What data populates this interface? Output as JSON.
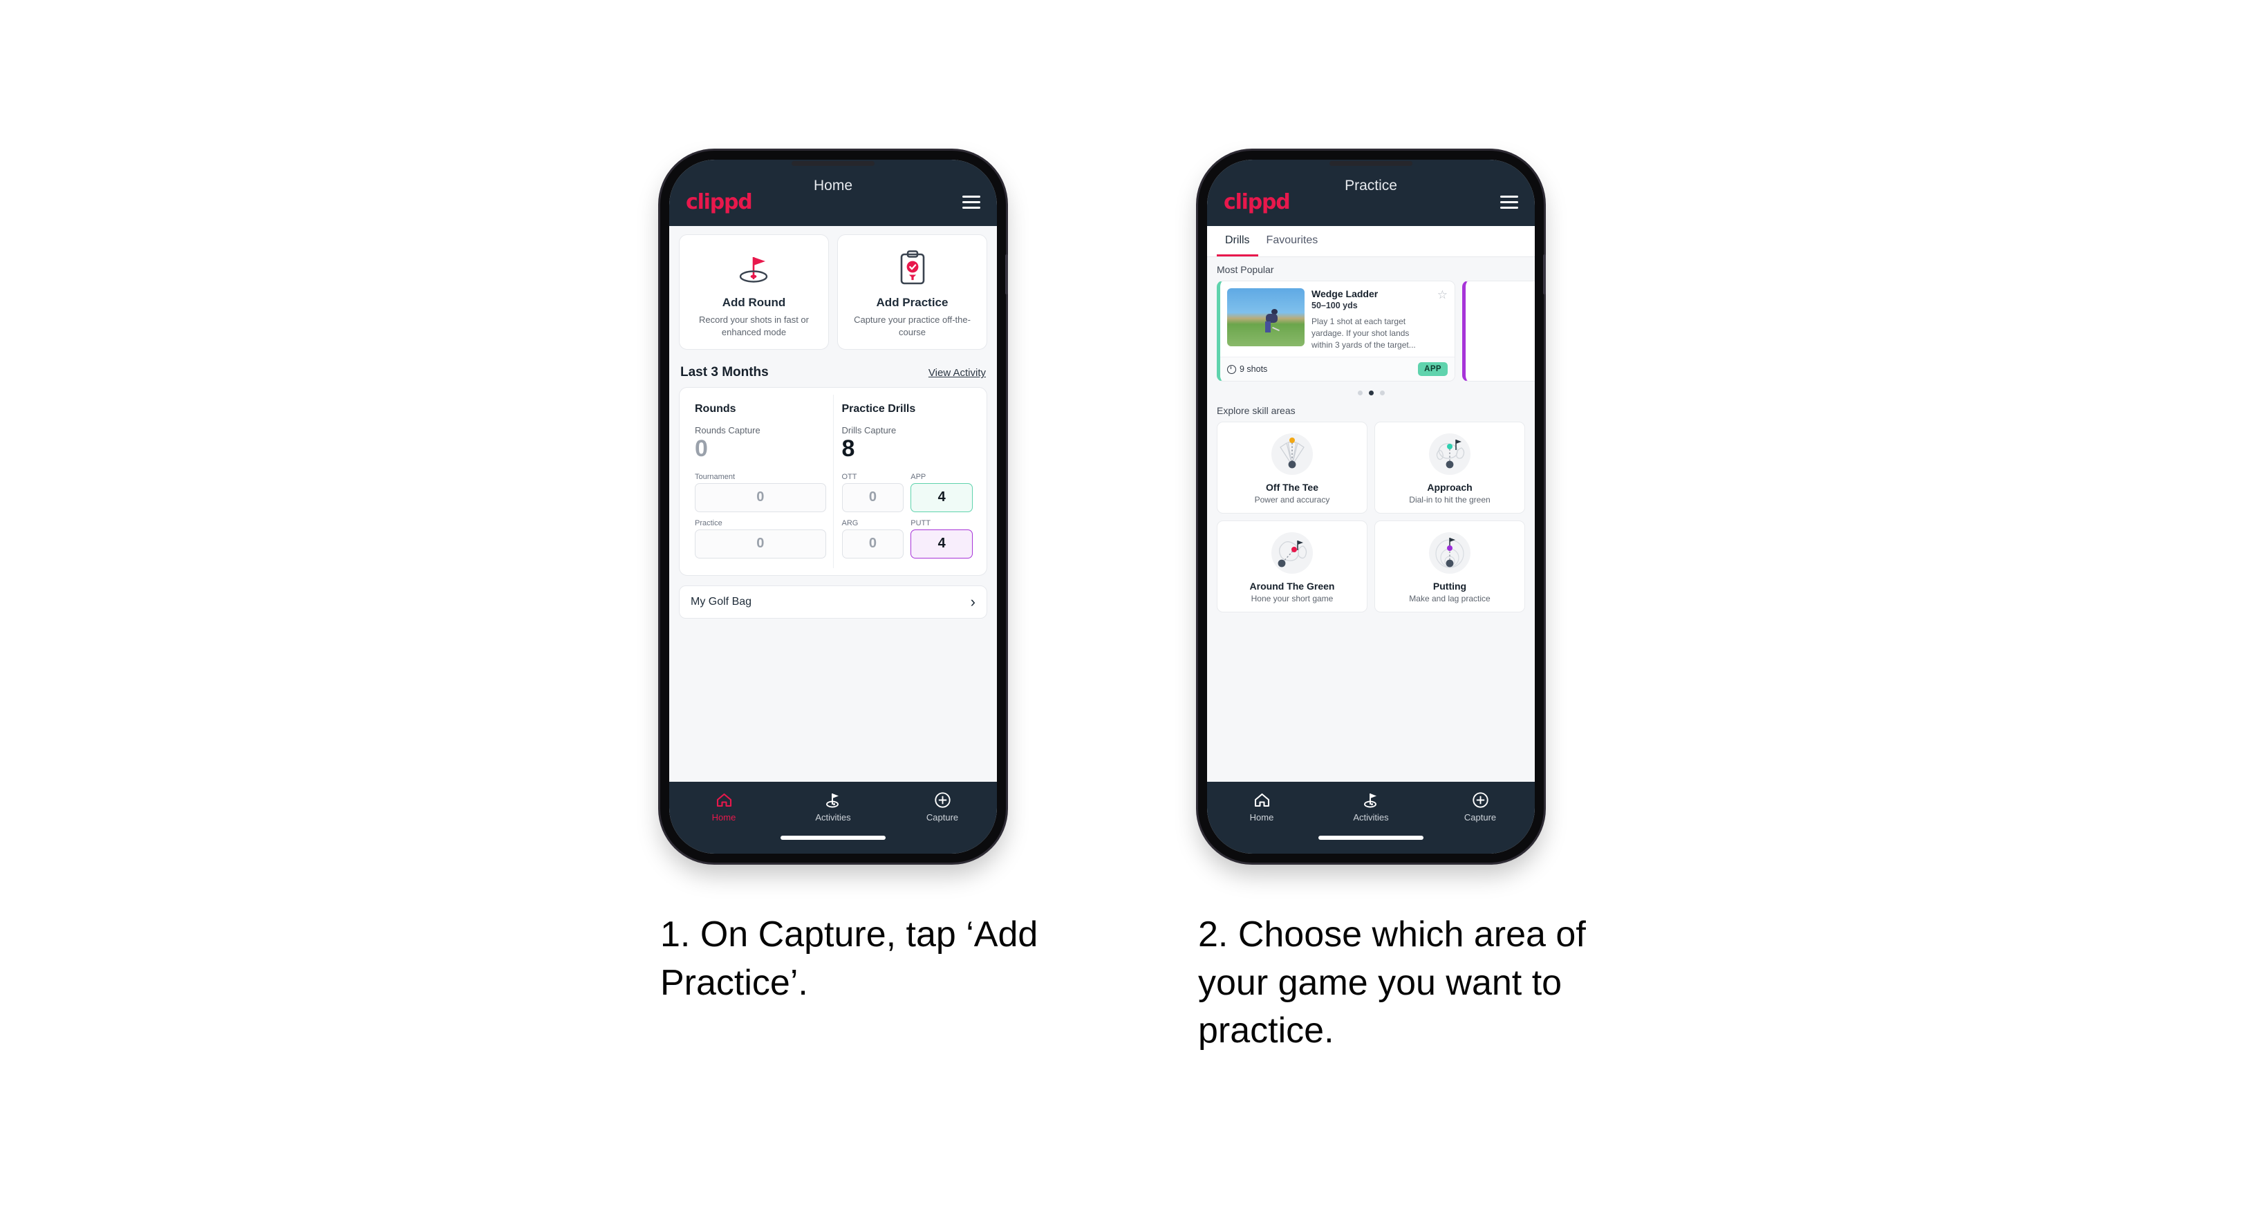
{
  "brand": {
    "logo_text": "clippd",
    "accent": "#e8184c",
    "header_bg": "#1e2b38"
  },
  "phone1": {
    "header": {
      "title": "Home",
      "menu_icon": "hamburger-icon"
    },
    "quick_actions": [
      {
        "icon": "golf-flag-hole-icon",
        "title": "Add Round",
        "subtitle": "Record your shots in fast or enhanced mode"
      },
      {
        "icon": "clipboard-check-tee-icon",
        "title": "Add Practice",
        "subtitle": "Capture your practice off-the-course"
      }
    ],
    "section": {
      "title": "Last 3 Months",
      "link": "View Activity"
    },
    "stats": {
      "rounds": {
        "col_title": "Rounds",
        "capture_label": "Rounds Capture",
        "capture_value": "0",
        "breakdown": [
          {
            "label": "Tournament",
            "value": "0",
            "highlight": "none"
          },
          {
            "label": "Practice",
            "value": "0",
            "highlight": "none"
          }
        ]
      },
      "drills": {
        "col_title": "Practice Drills",
        "capture_label": "Drills Capture",
        "capture_value": "8",
        "breakdown": [
          {
            "label": "OTT",
            "value": "0",
            "highlight": "none"
          },
          {
            "label": "APP",
            "value": "4",
            "highlight": "green"
          },
          {
            "label": "ARG",
            "value": "0",
            "highlight": "none"
          },
          {
            "label": "PUTT",
            "value": "4",
            "highlight": "purple"
          }
        ]
      }
    },
    "golf_bag": {
      "label": "My Golf Bag",
      "chevron": "chevron-right-icon"
    },
    "tabbar": [
      {
        "icon": "home-icon",
        "label": "Home",
        "active": true
      },
      {
        "icon": "golf-flag-icon",
        "label": "Activities",
        "active": false
      },
      {
        "icon": "plus-circle-icon",
        "label": "Capture",
        "active": false
      }
    ]
  },
  "phone2": {
    "header": {
      "title": "Practice",
      "menu_icon": "hamburger-icon"
    },
    "tabs": [
      {
        "label": "Drills",
        "active": true
      },
      {
        "label": "Favourites",
        "active": false
      }
    ],
    "most_popular": {
      "section_label": "Most Popular",
      "card": {
        "name": "Wedge Ladder",
        "yardage": "50–100 yds",
        "description": "Play 1 shot at each target yardage. If your shot lands within 3 yards of the target...",
        "shots": "9 shots",
        "tag": "APP",
        "tag_color": "#5fd3ad",
        "accent": "#5fd3ad",
        "star_icon": "star-outline-icon",
        "thumbnail": "golfer-chipping-photo"
      },
      "next_card_accent": "#a734d8",
      "dots": [
        false,
        true,
        false
      ]
    },
    "skills": {
      "section_label": "Explore skill areas",
      "items": [
        {
          "icon": "off-the-tee-icon",
          "name": "Off The Tee",
          "sub": "Power and accuracy",
          "dot_color": "#f2a714"
        },
        {
          "icon": "approach-icon",
          "name": "Approach",
          "sub": "Dial-in to hit the green",
          "dot_color": "#2fd0b0"
        },
        {
          "icon": "around-the-green-icon",
          "name": "Around The Green",
          "sub": "Hone your short game",
          "dot_color": "#e8184c"
        },
        {
          "icon": "putting-icon",
          "name": "Putting",
          "sub": "Make and lag practice",
          "dot_color": "#9b2fd8"
        }
      ]
    },
    "tabbar": [
      {
        "icon": "home-icon",
        "label": "Home",
        "active": false
      },
      {
        "icon": "golf-flag-icon",
        "label": "Activities",
        "active": false
      },
      {
        "icon": "plus-circle-icon",
        "label": "Capture",
        "active": false
      }
    ]
  },
  "captions": {
    "step1": "1. On Capture, tap ‘Add Practice’.",
    "step2": "2. Choose which area of your game you want to practice."
  }
}
